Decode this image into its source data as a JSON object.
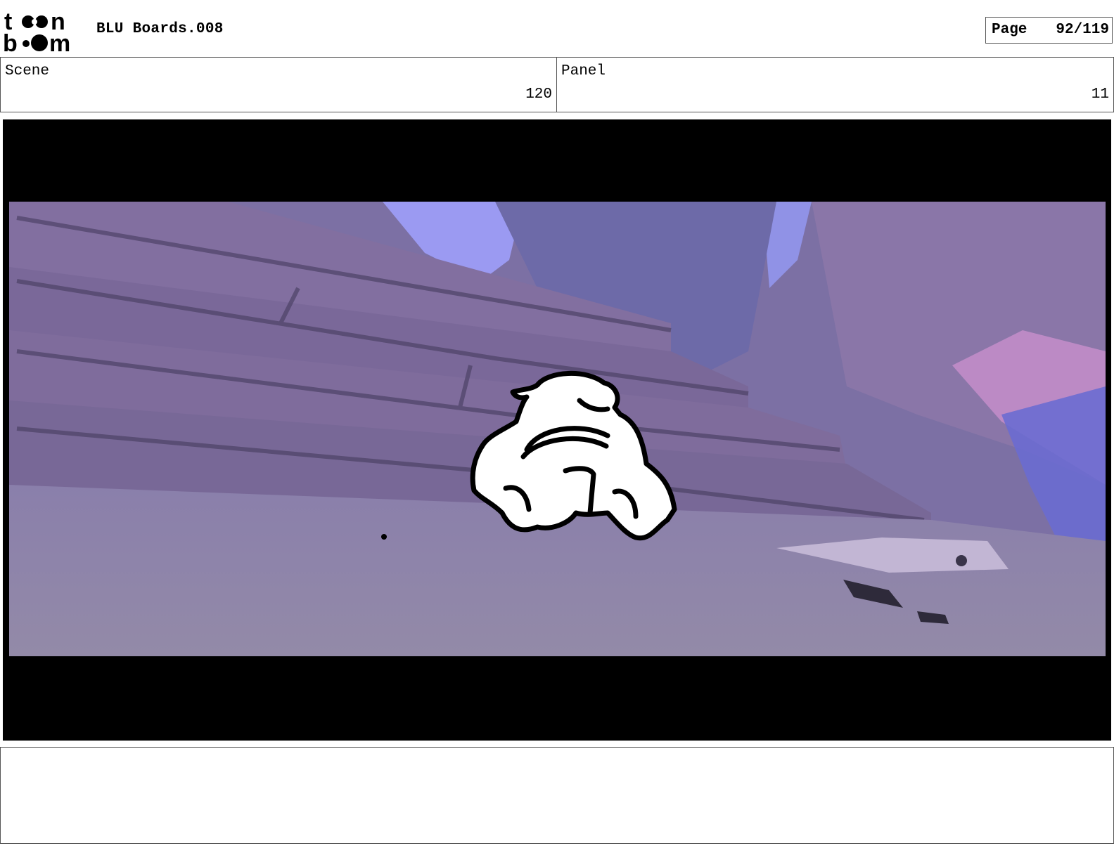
{
  "header": {
    "logo_text_top": "toon",
    "logo_text_bottom": "boom",
    "title": "BLU Boards.008",
    "page_label": "Page",
    "page_number": "92/119"
  },
  "info": {
    "scene_label": "Scene",
    "scene_value": "120",
    "panel_label": "Panel",
    "panel_value": "11"
  },
  "frame": {
    "subject": "storyboard-panel-image",
    "colors": {
      "letterbox": "#000000",
      "sky": "#9a9af0",
      "wood": "#7f6f9e",
      "ground": "#8c82a8",
      "foliage": "#6f6cae",
      "pink": "#c78cc6",
      "sketch_line": "#000000"
    }
  },
  "notes": {
    "text": ""
  }
}
